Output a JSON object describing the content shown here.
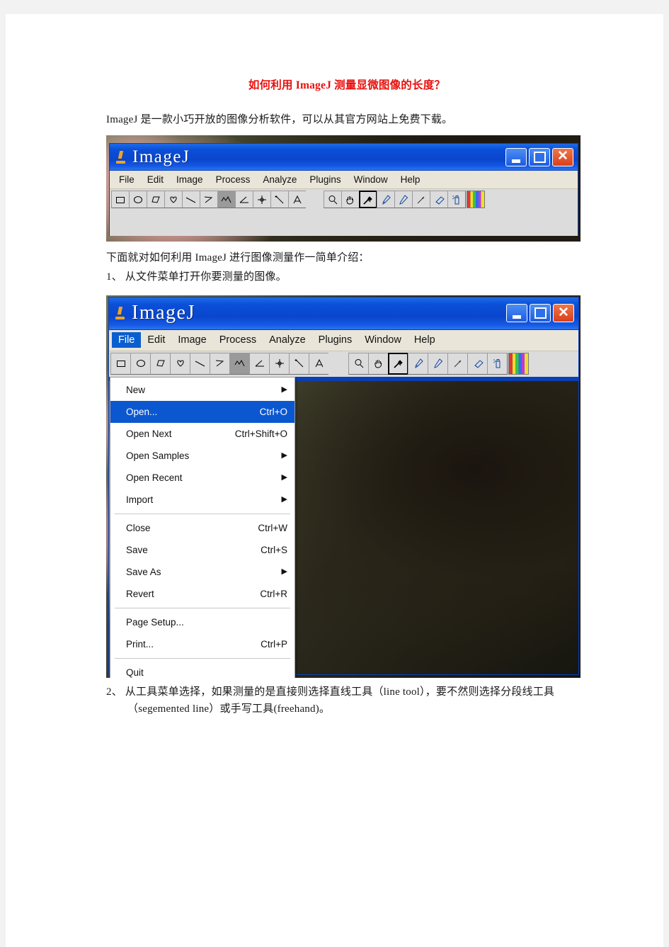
{
  "document": {
    "title": "如何利用 ImageJ 测量显微图像的长度？",
    "paragraph_1": "ImageJ 是一款小巧开放的图像分析软件，可以从其官方网站上免费下载。",
    "paragraph_2": "下面就对如何利用 ImageJ 进行图像测量作一简单介绍：",
    "step_1": "1、 从文件菜单打开你要测量的图像。",
    "step_2": "2、 从工具菜单选择，如果测量的是直接则选择直线工具（line tool），要不然则选择分段线工具（segemented line）或手写工具(freehand)。"
  },
  "colors": {
    "title_red": "#e8110e",
    "titlebar_blue": "#0b4fd8",
    "menu_highlight": "#0b57d0",
    "menubar_bg": "#e9e5d8",
    "toolbar_bg": "#dcdcdc",
    "close_button_red": "#d8401c"
  },
  "imagej_window": {
    "title": "ImageJ",
    "logo_icon": "microscope-icon",
    "window_buttons": [
      {
        "name": "minimize-button",
        "glyph": "_"
      },
      {
        "name": "maximize-button",
        "glyph": "□"
      },
      {
        "name": "close-button",
        "glyph": "✕"
      }
    ],
    "menubar": [
      "File",
      "Edit",
      "Image",
      "Process",
      "Analyze",
      "Plugins",
      "Window",
      "Help"
    ],
    "toolbar": [
      {
        "name": "rectangle-tool-icon",
        "selected": false
      },
      {
        "name": "oval-tool-icon",
        "selected": false
      },
      {
        "name": "polygon-tool-icon",
        "selected": false
      },
      {
        "name": "freehand-selection-tool-icon",
        "selected": false
      },
      {
        "name": "straight-line-tool-icon",
        "selected": false
      },
      {
        "name": "segmented-line-tool-icon",
        "selected": false
      },
      {
        "name": "freehand-line-tool-icon",
        "selected": true
      },
      {
        "name": "angle-tool-icon",
        "selected": false
      },
      {
        "name": "point-tool-icon",
        "selected": false
      },
      {
        "name": "wand-tool-icon",
        "selected": false
      },
      {
        "name": "text-tool-icon",
        "selected": false
      },
      {
        "name": "toolbar-spacer",
        "selected": false
      },
      {
        "name": "magnifier-tool-icon",
        "selected": false
      },
      {
        "name": "hand-tool-icon",
        "selected": false
      },
      {
        "name": "dropper-tool-icon",
        "selected": true
      },
      {
        "name": "paintbrush-tool-icon",
        "selected": false
      },
      {
        "name": "pencil-tool-icon",
        "selected": false
      },
      {
        "name": "arrow-tool-icon",
        "selected": false
      },
      {
        "name": "eraser-tool-icon",
        "selected": false
      },
      {
        "name": "spray-can-tool-icon",
        "selected": false
      },
      {
        "name": "lut-color-bar-icon",
        "selected": false
      }
    ]
  },
  "file_menu": {
    "open_menu_label": "File",
    "items": [
      {
        "label": "New",
        "shortcut": "",
        "submenu": true,
        "highlighted": false,
        "separator_after": false
      },
      {
        "label": "Open...",
        "shortcut": "Ctrl+O",
        "submenu": false,
        "highlighted": true,
        "separator_after": false
      },
      {
        "label": "Open Next",
        "shortcut": "Ctrl+Shift+O",
        "submenu": false,
        "highlighted": false,
        "separator_after": false
      },
      {
        "label": "Open Samples",
        "shortcut": "",
        "submenu": true,
        "highlighted": false,
        "separator_after": false
      },
      {
        "label": "Open Recent",
        "shortcut": "",
        "submenu": true,
        "highlighted": false,
        "separator_after": false
      },
      {
        "label": "Import",
        "shortcut": "",
        "submenu": true,
        "highlighted": false,
        "separator_after": true
      },
      {
        "label": "Close",
        "shortcut": "Ctrl+W",
        "submenu": false,
        "highlighted": false,
        "separator_after": false
      },
      {
        "label": "Save",
        "shortcut": "Ctrl+S",
        "submenu": false,
        "highlighted": false,
        "separator_after": false
      },
      {
        "label": "Save As",
        "shortcut": "",
        "submenu": true,
        "highlighted": false,
        "separator_after": false
      },
      {
        "label": "Revert",
        "shortcut": "Ctrl+R",
        "submenu": false,
        "highlighted": false,
        "separator_after": true
      },
      {
        "label": "Page Setup...",
        "shortcut": "",
        "submenu": false,
        "highlighted": false,
        "separator_after": false
      },
      {
        "label": "Print...",
        "shortcut": "Ctrl+P",
        "submenu": false,
        "highlighted": false,
        "separator_after": true
      },
      {
        "label": "Quit",
        "shortcut": "",
        "submenu": false,
        "highlighted": false,
        "separator_after": false
      }
    ]
  }
}
